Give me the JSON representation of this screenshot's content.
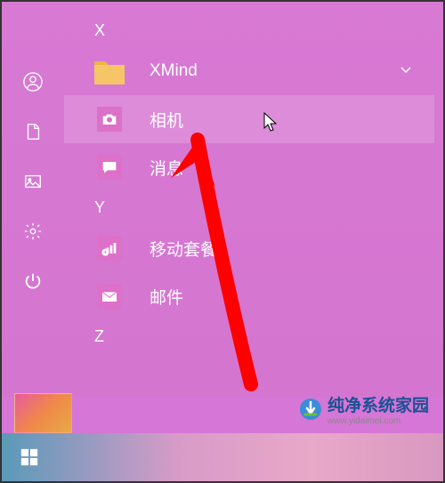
{
  "sections": {
    "x": "X",
    "y": "Y",
    "z": "Z"
  },
  "apps": {
    "xmind": {
      "label": "XMind"
    },
    "camera": {
      "label": "相机"
    },
    "messages": {
      "label": "消息"
    },
    "mobile": {
      "label": "移动套餐"
    },
    "mail": {
      "label": "邮件"
    }
  },
  "watermark": {
    "text": "纯净系统家园",
    "url": "www.yidaimei.com"
  },
  "colors": {
    "bg": "#d676d6",
    "accent": "#e070c0",
    "folder": "#f5c568"
  }
}
